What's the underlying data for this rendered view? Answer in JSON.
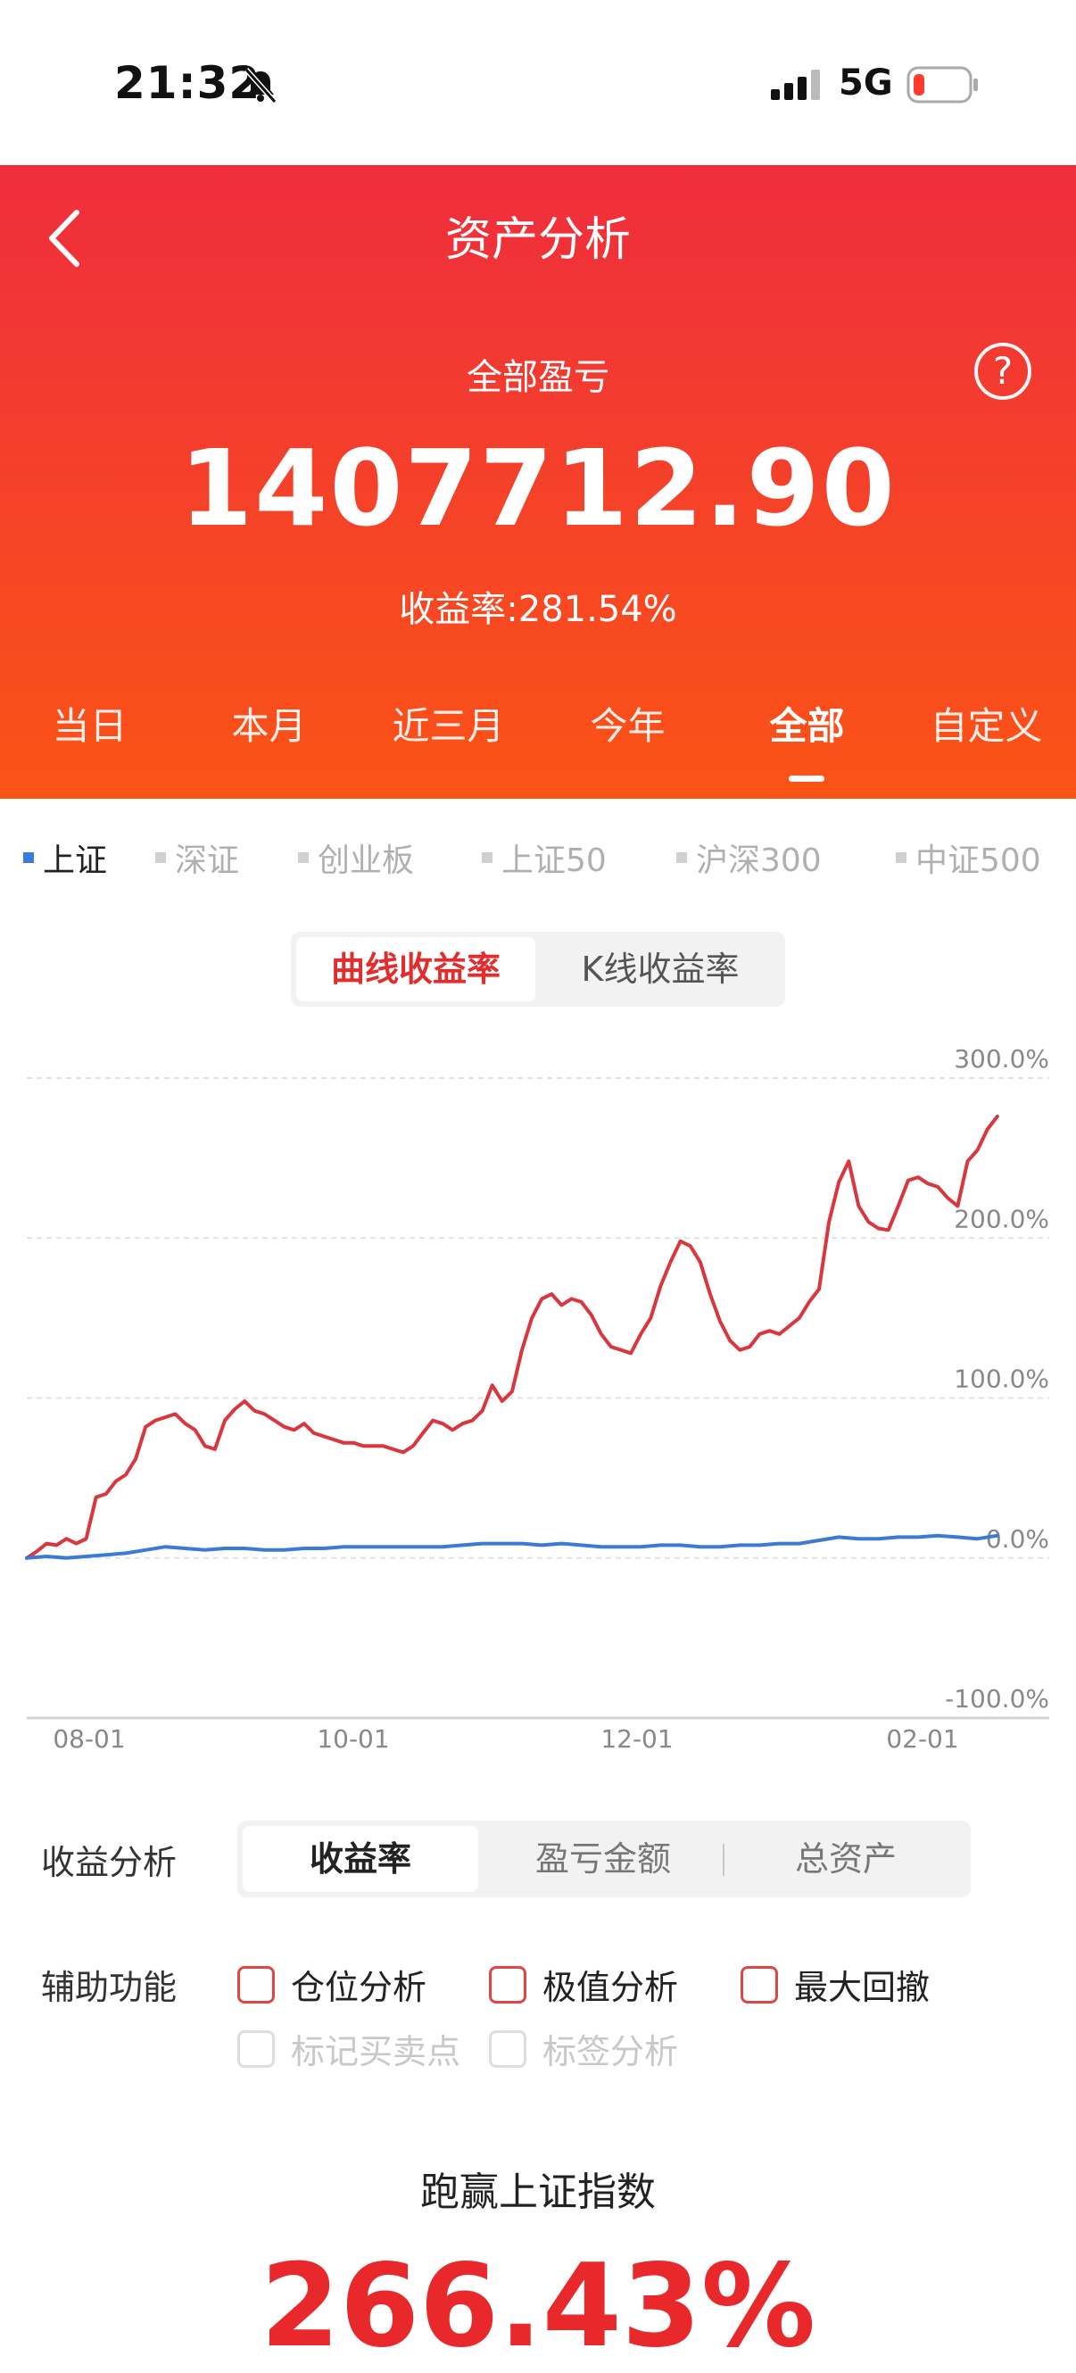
{
  "status_bar": {
    "time": "21:32",
    "network": "5G"
  },
  "header": {
    "title": "资产分析",
    "subtitle": "全部盈亏",
    "amount": "1407712.90",
    "rate_text": "收益率:281.54%",
    "periods": [
      "当日",
      "本月",
      "近三月",
      "今年",
      "全部",
      "自定义"
    ],
    "active_period": "全部"
  },
  "index_tabs": [
    "上证",
    "深证",
    "创业板",
    "上证50",
    "沪深300",
    "中证500"
  ],
  "active_index": "上证",
  "chart_toggle": {
    "curve": "曲线收益率",
    "kline": "K线收益率",
    "active": "曲线收益率"
  },
  "chart_data": {
    "type": "line",
    "x_ticks": [
      "08-01",
      "10-01",
      "12-01",
      "02-01"
    ],
    "y_ticks": [
      "300.0%",
      "200.0%",
      "100.0%",
      "0.0%",
      "-100.0%"
    ],
    "ylim": [
      -100,
      300
    ],
    "series": [
      {
        "color": "#d9363e",
        "values": [
          [
            0,
            0
          ],
          [
            2,
            4
          ],
          [
            4,
            9
          ],
          [
            6,
            8
          ],
          [
            8,
            12
          ],
          [
            10,
            9
          ],
          [
            12,
            12
          ],
          [
            14,
            38
          ],
          [
            16,
            40
          ],
          [
            18,
            48
          ],
          [
            20,
            52
          ],
          [
            22,
            62
          ],
          [
            24,
            82
          ],
          [
            26,
            86
          ],
          [
            28,
            88
          ],
          [
            30,
            90
          ],
          [
            32,
            84
          ],
          [
            34,
            80
          ],
          [
            36,
            70
          ],
          [
            38,
            68
          ],
          [
            40,
            86
          ],
          [
            42,
            93
          ],
          [
            44,
            98
          ],
          [
            46,
            92
          ],
          [
            48,
            90
          ],
          [
            50,
            86
          ],
          [
            52,
            82
          ],
          [
            54,
            80
          ],
          [
            56,
            84
          ],
          [
            58,
            78
          ],
          [
            60,
            76
          ],
          [
            62,
            74
          ],
          [
            64,
            72
          ],
          [
            66,
            72
          ],
          [
            68,
            70
          ],
          [
            70,
            70
          ],
          [
            72,
            70
          ],
          [
            74,
            68
          ],
          [
            76,
            66
          ],
          [
            78,
            70
          ],
          [
            80,
            78
          ],
          [
            82,
            86
          ],
          [
            84,
            84
          ],
          [
            86,
            80
          ],
          [
            88,
            84
          ],
          [
            90,
            86
          ],
          [
            92,
            92
          ],
          [
            94,
            108
          ],
          [
            96,
            98
          ],
          [
            98,
            104
          ],
          [
            100,
            130
          ],
          [
            102,
            150
          ],
          [
            104,
            162
          ],
          [
            106,
            165
          ],
          [
            108,
            158
          ],
          [
            110,
            162
          ],
          [
            112,
            160
          ],
          [
            114,
            152
          ],
          [
            116,
            140
          ],
          [
            118,
            132
          ],
          [
            120,
            130
          ],
          [
            122,
            128
          ],
          [
            124,
            140
          ],
          [
            126,
            150
          ],
          [
            128,
            170
          ],
          [
            130,
            185
          ],
          [
            132,
            198
          ],
          [
            134,
            195
          ],
          [
            136,
            185
          ],
          [
            138,
            165
          ],
          [
            140,
            148
          ],
          [
            142,
            136
          ],
          [
            144,
            130
          ],
          [
            146,
            132
          ],
          [
            148,
            140
          ],
          [
            150,
            142
          ],
          [
            152,
            140
          ],
          [
            154,
            145
          ],
          [
            156,
            150
          ],
          [
            158,
            160
          ],
          [
            160,
            168
          ],
          [
            162,
            210
          ],
          [
            164,
            235
          ],
          [
            166,
            248
          ],
          [
            168,
            220
          ],
          [
            170,
            210
          ],
          [
            172,
            206
          ],
          [
            174,
            205
          ],
          [
            176,
            220
          ],
          [
            178,
            236
          ],
          [
            180,
            238
          ],
          [
            182,
            234
          ],
          [
            184,
            232
          ],
          [
            186,
            225
          ],
          [
            188,
            220
          ],
          [
            190,
            248
          ],
          [
            192,
            255
          ],
          [
            194,
            268
          ],
          [
            196,
            276
          ]
        ]
      },
      {
        "color": "#3d7ad6",
        "values": [
          [
            0,
            0
          ],
          [
            4,
            1
          ],
          [
            8,
            0
          ],
          [
            12,
            1
          ],
          [
            16,
            2
          ],
          [
            20,
            3
          ],
          [
            24,
            5
          ],
          [
            28,
            7
          ],
          [
            32,
            6
          ],
          [
            36,
            5
          ],
          [
            40,
            6
          ],
          [
            44,
            6
          ],
          [
            48,
            5
          ],
          [
            52,
            5
          ],
          [
            56,
            6
          ],
          [
            60,
            6
          ],
          [
            64,
            7
          ],
          [
            68,
            7
          ],
          [
            72,
            7
          ],
          [
            76,
            7
          ],
          [
            80,
            7
          ],
          [
            84,
            7
          ],
          [
            88,
            8
          ],
          [
            92,
            9
          ],
          [
            96,
            9
          ],
          [
            100,
            9
          ],
          [
            104,
            8
          ],
          [
            108,
            9
          ],
          [
            112,
            8
          ],
          [
            116,
            7
          ],
          [
            120,
            7
          ],
          [
            124,
            7
          ],
          [
            128,
            8
          ],
          [
            132,
            8
          ],
          [
            136,
            7
          ],
          [
            140,
            7
          ],
          [
            144,
            8
          ],
          [
            148,
            8
          ],
          [
            152,
            9
          ],
          [
            156,
            9
          ],
          [
            160,
            11
          ],
          [
            164,
            13
          ],
          [
            168,
            12
          ],
          [
            172,
            12
          ],
          [
            176,
            13
          ],
          [
            180,
            13
          ],
          [
            184,
            14
          ],
          [
            188,
            13
          ],
          [
            192,
            12
          ],
          [
            196,
            14
          ]
        ]
      }
    ]
  },
  "analysis": {
    "label": "收益分析",
    "segments": [
      "收益率",
      "盈亏金额",
      "总资产"
    ],
    "active_segment": "收益率"
  },
  "aux": {
    "label": "辅助功能",
    "options": [
      "仓位分析",
      "极值分析",
      "最大回撤"
    ],
    "disabled_options": [
      "标记买卖点",
      "标签分析"
    ]
  },
  "beat": {
    "label": "跑赢上证指数",
    "value": "266.43%"
  }
}
